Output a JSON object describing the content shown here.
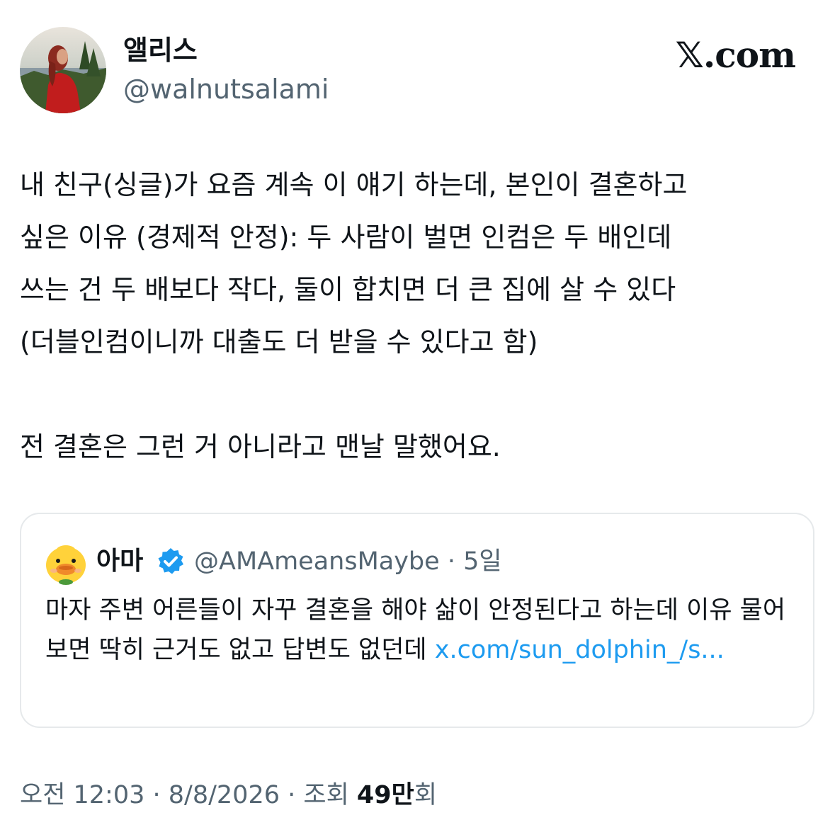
{
  "author": {
    "name": "앨리스",
    "handle": "@walnutsalami"
  },
  "brand": {
    "x_mark": "𝕏",
    "domain": ".com"
  },
  "tweet": {
    "text": "내 친구(싱글)가 요즘 계속 이 얘기 하는데, 본인이 결혼하고\n싶은 이유 (경제적 안정): 두 사람이 벌면 인컴은 두 배인데\n쓰는 건 두 배보다 작다, 둘이 합치면 더 큰 집에 살 수 있다\n(더블인컴이니까 대출도 더 받을 수 있다고 함)\n\n전 결혼은 그런 거 아니라고 맨날 말했어요."
  },
  "quote": {
    "name": "아마",
    "handle": "@AMAmeansMaybe",
    "separator": " · ",
    "age": "5일",
    "text": "마자 주변 어른들이 자꾸 결혼을 해야 삶이 안정된다고 하는데 이유 물어보면 딱히 근거도 없고 답변도 없던데 ",
    "link": "x.com/sun_dolphin_/s...",
    "verified_color": "#1d9bf0"
  },
  "footer": {
    "time": "오전 12:03",
    "sep1": " · ",
    "date": "8/8/2026",
    "sep2": " · ",
    "views_label": "조회 ",
    "views_count": "49만",
    "views_suffix": "회"
  },
  "icons": {
    "avatar": "avatar-photo",
    "quote_avatar": "duck-avatar-icon",
    "verified": "verified-badge-icon"
  }
}
